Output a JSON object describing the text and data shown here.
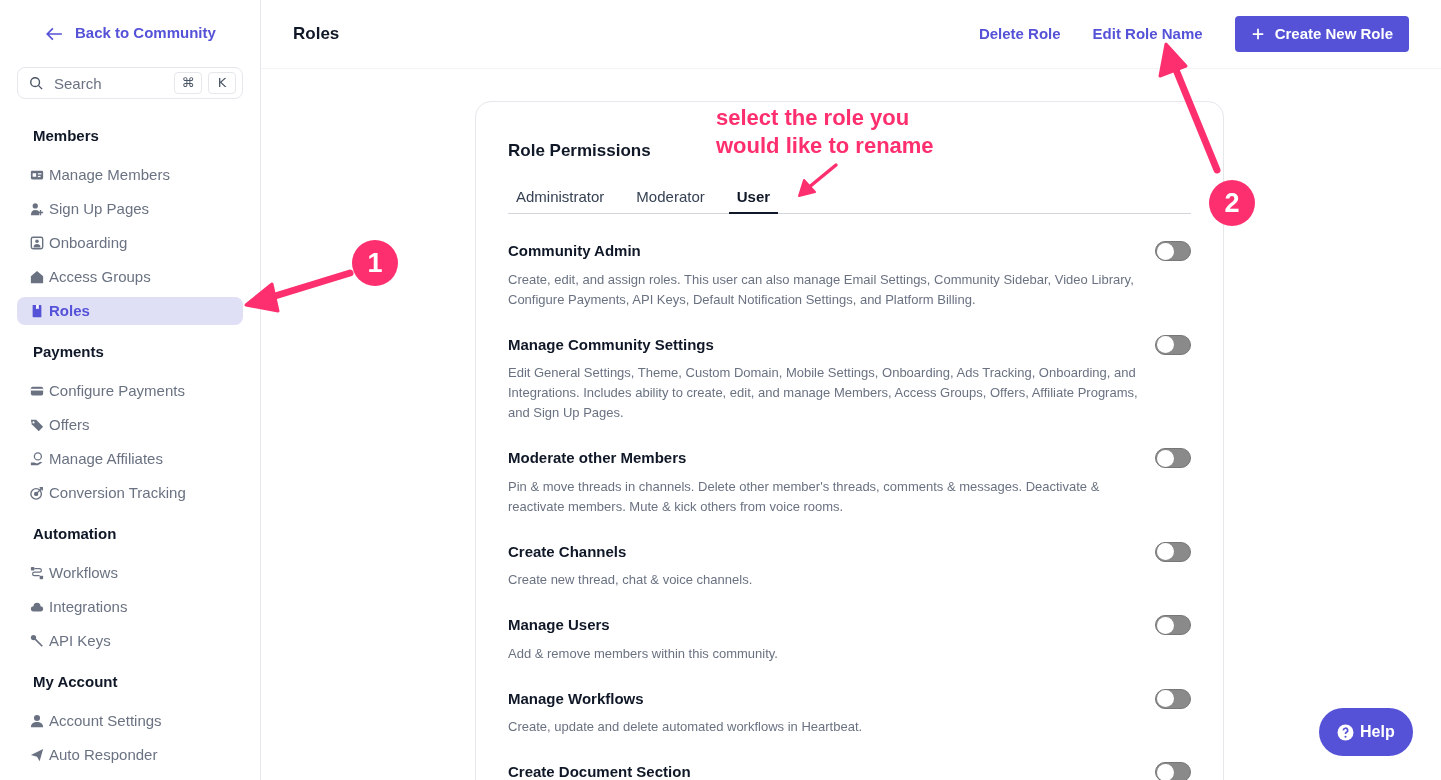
{
  "sidebar": {
    "back_link": "Back to Community",
    "search": {
      "placeholder": "Search",
      "shortcut_keys": [
        "⌘",
        "K"
      ]
    },
    "sections": [
      {
        "title": "Members",
        "items": [
          {
            "label": "Manage Members",
            "selected": false
          },
          {
            "label": "Sign Up Pages",
            "selected": false
          },
          {
            "label": "Onboarding",
            "selected": false
          },
          {
            "label": "Access Groups",
            "selected": false
          },
          {
            "label": "Roles",
            "selected": true
          }
        ]
      },
      {
        "title": "Payments",
        "items": [
          {
            "label": "Configure Payments",
            "selected": false
          },
          {
            "label": "Offers",
            "selected": false
          },
          {
            "label": "Manage Affiliates",
            "selected": false
          },
          {
            "label": "Conversion Tracking",
            "selected": false
          }
        ]
      },
      {
        "title": "Automation",
        "items": [
          {
            "label": "Workflows",
            "selected": false
          },
          {
            "label": "Integrations",
            "selected": false
          },
          {
            "label": "API Keys",
            "selected": false
          }
        ]
      },
      {
        "title": "My Account",
        "items": [
          {
            "label": "Account Settings",
            "selected": false
          },
          {
            "label": "Auto Responder",
            "selected": false
          }
        ]
      }
    ]
  },
  "header": {
    "title": "Roles",
    "actions": [
      {
        "label": "Delete Role",
        "kind": "link"
      },
      {
        "label": "Edit Role Name",
        "kind": "link"
      },
      {
        "label": "Create New Role",
        "kind": "primary"
      }
    ]
  },
  "card": {
    "title": "Role Permissions",
    "tabs": [
      {
        "label": "Administrator",
        "selected": false
      },
      {
        "label": "Moderator",
        "selected": false
      },
      {
        "label": "User",
        "selected": true
      }
    ],
    "permissions": [
      {
        "name": "Community Admin",
        "description": "Create, edit, and assign roles. This user can also manage Email Settings, Community Sidebar, Video Library, Configure Payments, API Keys, Default Notification Settings, and Platform Billing.",
        "on": false
      },
      {
        "name": "Manage Community Settings",
        "description": "Edit General Settings, Theme, Custom Domain, Mobile Settings, Onboarding, Ads Tracking, Onboarding, and Integrations. Includes ability to create, edit, and manage Members, Access Groups, Offers, Affiliate Programs, and Sign Up Pages.",
        "on": false
      },
      {
        "name": "Moderate other Members",
        "description": "Pin & move threads in channels. Delete other member's threads, comments & messages. Deactivate & reactivate members. Mute & kick others from voice rooms.",
        "on": false
      },
      {
        "name": "Create Channels",
        "description": "Create new thread, chat & voice channels.",
        "on": false
      },
      {
        "name": "Manage Users",
        "description": "Add & remove members within this community.",
        "on": false
      },
      {
        "name": "Manage Workflows",
        "description": "Create, update and delete automated workflows in Heartbeat.",
        "on": false
      },
      {
        "name": "Create Document Section",
        "on": false
      }
    ]
  },
  "help_button": "Help",
  "annotations": [
    {
      "kind": "callout",
      "text": "select the role you\nwould like to rename"
    },
    {
      "kind": "badge",
      "text": "1"
    },
    {
      "kind": "badge",
      "text": "2"
    }
  ]
}
